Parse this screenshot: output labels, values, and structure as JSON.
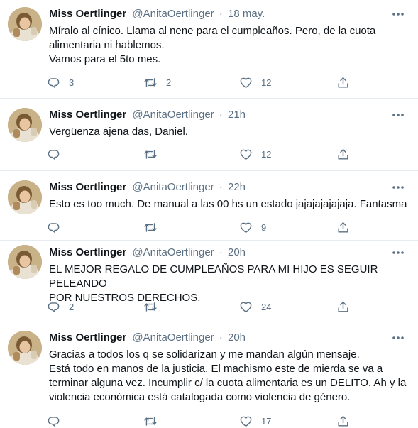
{
  "tweets": [
    {
      "name": "Miss Oertlinger",
      "handle": "@AnitaOertlinger",
      "time": "18 may.",
      "lines": [
        "Míralo al cínico. Llama al nene para el cumpleaños. Pero, de la cuota",
        "alimentaria ni hablemos.",
        "Vamos para el 5to mes."
      ],
      "replies": "3",
      "retweets": "2",
      "likes": "12"
    },
    {
      "name": "Miss Oertlinger",
      "handle": "@AnitaOertlinger",
      "time": "21h",
      "lines": [
        "Vergüenza ajena das, Daniel."
      ],
      "replies": "",
      "retweets": "",
      "likes": "12"
    },
    {
      "name": "Miss Oertlinger",
      "handle": "@AnitaOertlinger",
      "time": "22h",
      "lines": [
        "Esto es too much. De manual a las 00 hs un estado jajajajajajaja. Fantasma"
      ],
      "replies": "",
      "retweets": "",
      "likes": "9"
    },
    {
      "name": "Miss Oertlinger",
      "handle": "@AnitaOertlinger",
      "time": "20h",
      "lines": [
        "EL MEJOR REGALO DE CUMPLEAÑOS PARA MI HIJO ES SEGUIR PELEANDO",
        "POR NUESTROS DERECHOS."
      ],
      "replies": "2",
      "retweets": "",
      "likes": "24"
    },
    {
      "name": "Miss Oertlinger",
      "handle": "@AnitaOertlinger",
      "time": "20h",
      "lines": [
        "Gracias a todos los q se solidarizan y me mandan algún mensaje.",
        "Está todo en manos de la justicia. El machismo este de mierda se va a",
        "terminar alguna vez. Incumplir c/ la cuota alimentaria es un DELITO. Ah y la",
        "violencia económica está catalogada como violencia de género."
      ],
      "replies": "",
      "retweets": "",
      "likes": "17"
    }
  ],
  "icons": {
    "reply": "reply-icon",
    "retweet": "retweet-icon",
    "like": "heart-icon",
    "share": "share-icon",
    "more": "more-icon"
  },
  "colors": {
    "text": "#0f1419",
    "muted": "#5b7083",
    "divider": "#e6ecf0"
  }
}
